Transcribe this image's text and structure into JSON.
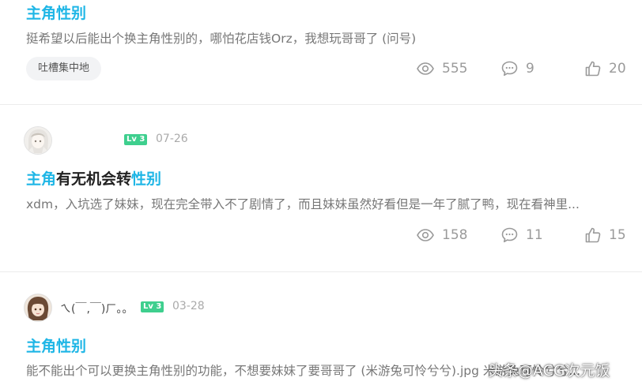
{
  "posts": [
    {
      "title": "主角性别",
      "excerpt": "挺希望以后能出个换主角性别的，哪怕花店钱Orz，我想玩哥哥了 (问号)",
      "tag": "吐槽集中地",
      "views": "555",
      "comments": "9",
      "likes": "20"
    },
    {
      "title_parts": [
        "主角",
        "有无机会转",
        "性别"
      ],
      "excerpt": "xdm，入坑选了妹妹，现在完全带入不了剧情了，而且妹妹虽然好看但是一年了腻了鸭，现在看神里...",
      "level": "Lv 3",
      "date": "07-26",
      "views": "158",
      "comments": "11",
      "likes": "15"
    },
    {
      "title": "主角性别",
      "excerpt": "能不能出个可以更换主角性别的功能，不想要妹妹了要哥哥了 (米游兔可怜兮兮).jpg 米游兔可怜兮兮...",
      "username": "ㄟ(￣,￣)ㄏ。。",
      "level": "Lv 3",
      "date": "03-28"
    }
  ],
  "watermark": "头条@ACG次元饭",
  "colors": {
    "highlight": "#1fb6e6",
    "level_badge": "#3ecf8e",
    "icon": "#9a9a9a"
  }
}
